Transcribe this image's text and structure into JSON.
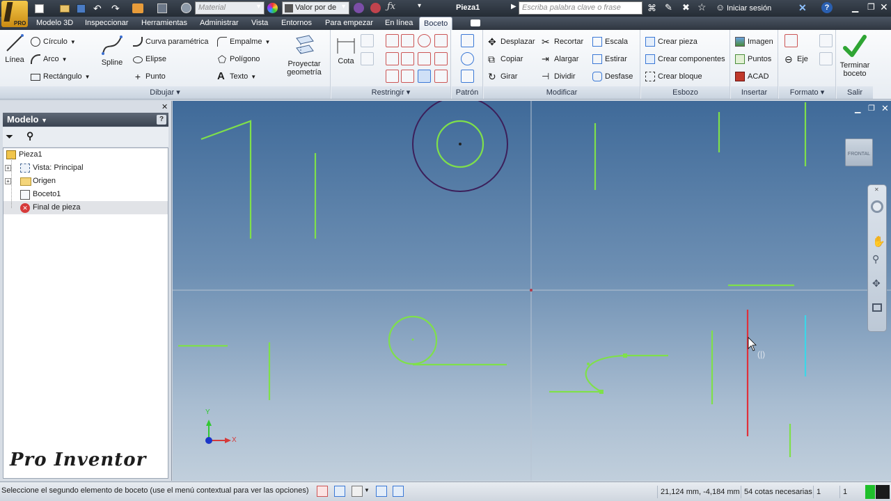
{
  "titlebar": {
    "app_badge": "PRO",
    "material_placeholder": "Material",
    "appearance_value": "Valor por de",
    "document_title": "Pieza1",
    "search_placeholder": "Escriba palabra clave o frase",
    "signin_label": "Iniciar sesión"
  },
  "menu": {
    "tabs": [
      "Modelo 3D",
      "Inspeccionar",
      "Herramientas",
      "Administrar",
      "Vista",
      "Entornos",
      "Para empezar",
      "En línea",
      "Boceto"
    ],
    "active_tab": "Boceto"
  },
  "ribbon": {
    "dibujar": {
      "title": "Dibujar",
      "linea": "Línea",
      "circulo": "Círculo",
      "arco": "Arco",
      "rectangulo": "Rectángulo",
      "spline": "Spline",
      "curva_parametrica": "Curva paramétrica",
      "elipse": "Elipse",
      "punto": "Punto",
      "empalme": "Empalme",
      "poligono": "Polígono",
      "texto": "Texto",
      "proyectar_line1": "Proyectar",
      "proyectar_line2": "geometría"
    },
    "restringir": {
      "title": "Restringir",
      "cota": "Cota"
    },
    "patron": {
      "title": "Patrón"
    },
    "modificar": {
      "title": "Modificar",
      "desplazar": "Desplazar",
      "copiar": "Copiar",
      "girar": "Girar",
      "recortar": "Recortar",
      "alargar": "Alargar",
      "dividir": "Dividir",
      "escala": "Escala",
      "estirar": "Estirar",
      "desfase": "Desfase"
    },
    "esbozo": {
      "title": "Esbozo",
      "crear_pieza": "Crear pieza",
      "crear_componentes": "Crear componentes",
      "crear_bloque": "Crear bloque"
    },
    "insertar": {
      "title": "Insertar",
      "imagen": "Imagen",
      "puntos": "Puntos",
      "acad": "ACAD"
    },
    "formato": {
      "title": "Formato",
      "eje": "Eje"
    },
    "salir": {
      "title": "Salir",
      "terminar_line1": "Terminar",
      "terminar_line2": "boceto"
    }
  },
  "browser": {
    "title": "Modelo",
    "help": "?",
    "nodes": [
      "Pieza1",
      "Vista: Principal",
      "Origen",
      "Boceto1",
      "Final de pieza"
    ]
  },
  "viewport": {
    "viewcube_label": "FRONTAL",
    "axis_x": "X",
    "axis_y": "Y",
    "watermark": "Pro Inventor"
  },
  "status": {
    "prompt": "Seleccione el segundo elemento de boceto (use el menú contextual para ver las opciones)",
    "coords": "21,124 mm, -4,184 mm",
    "dims_needed": "54 cotas necesarias",
    "field1": "1",
    "field2": "1"
  },
  "colors": {
    "sketch_green": "#7fe04a",
    "circle_purple": "#3c1f5a",
    "selected_red": "#e0303a",
    "cyan_line": "#3cd6e8",
    "accent_tab": "#2b6fd6"
  }
}
